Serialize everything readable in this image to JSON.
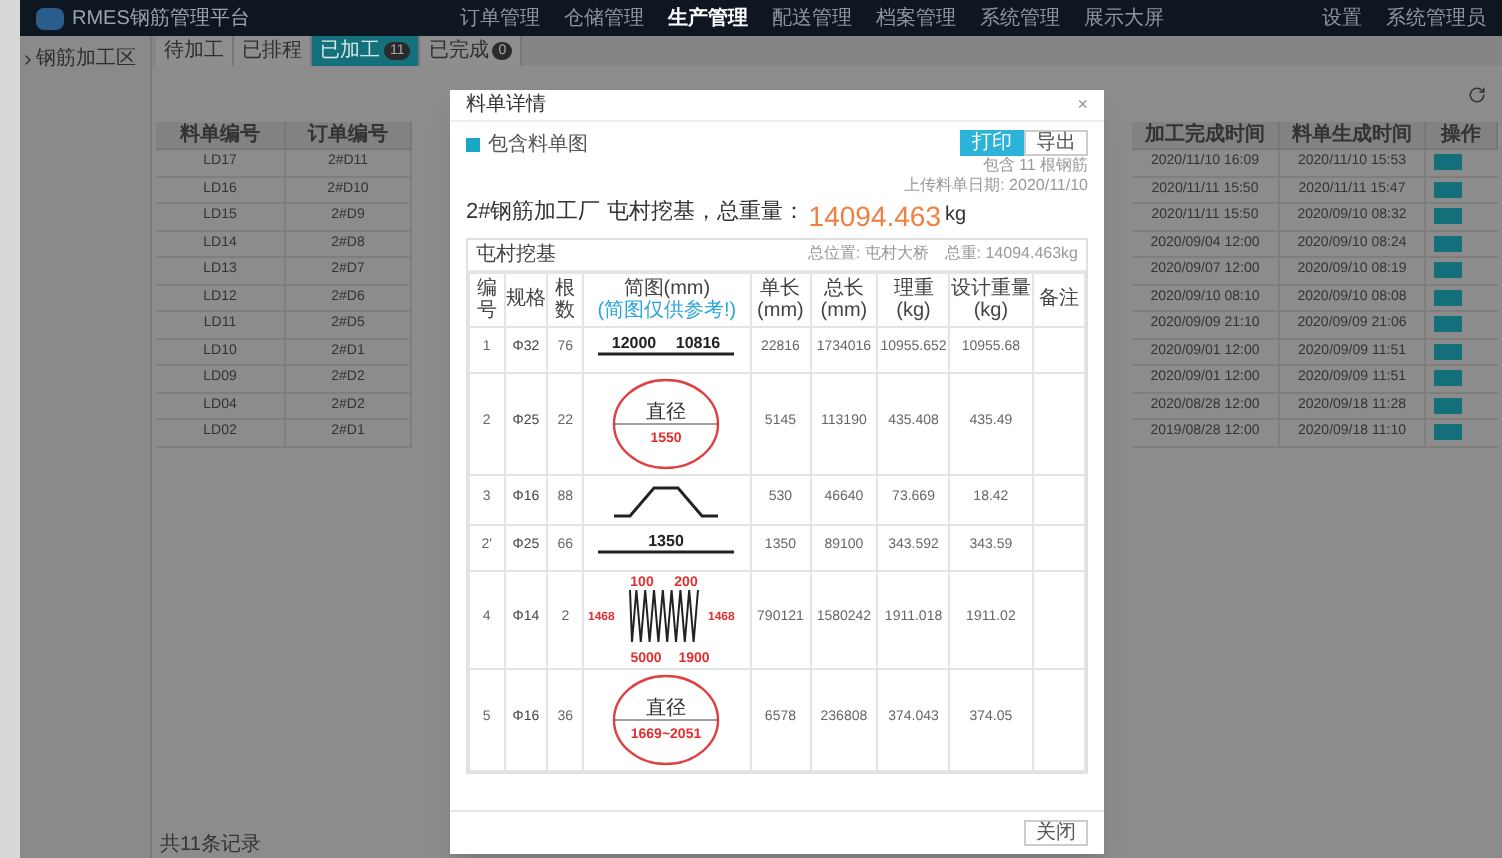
{
  "app": {
    "title": "RMES钢筋管理平台"
  },
  "nav": [
    {
      "label": "订单管理",
      "selected": false
    },
    {
      "label": "仓储管理",
      "selected": false
    },
    {
      "label": "生产管理",
      "selected": true
    },
    {
      "label": "配送管理",
      "selected": false
    },
    {
      "label": "档案管理",
      "selected": false
    },
    {
      "label": "系统管理",
      "selected": false
    },
    {
      "label": "展示大屏",
      "selected": false
    }
  ],
  "user_menu": [
    "设置",
    "系统管理员"
  ],
  "sidebar": {
    "items": [
      {
        "label": "钢筋加工区",
        "expanded": false
      }
    ]
  },
  "tabs": [
    {
      "label": "待加工",
      "selected": false
    },
    {
      "label": "已排程",
      "selected": false
    },
    {
      "label": "已加工",
      "count": "11",
      "selected": true
    },
    {
      "label": "已完成",
      "count": "0",
      "selected": false
    }
  ],
  "table": {
    "columns": [
      "料单编号",
      "订单编号",
      "加工完成时间",
      "料单生成时间",
      "操作"
    ],
    "rows": [
      [
        "LD17",
        "2#D11",
        "2020/11/10 16:09",
        "2020/11/10 15:53"
      ],
      [
        "LD16",
        "2#D10",
        "2020/11/11 15:50",
        "2020/11/11 15:47"
      ],
      [
        "LD15",
        "2#D9",
        "2020/11/11 15:50",
        "2020/09/10 08:32"
      ],
      [
        "LD14",
        "2#D8",
        "2020/09/04 12:00",
        "2020/09/10 08:24"
      ],
      [
        "LD13",
        "2#D7",
        "2020/09/07 12:00",
        "2020/09/10 08:19"
      ],
      [
        "LD12",
        "2#D6",
        "2020/09/10 08:10",
        "2020/09/10 08:08"
      ],
      [
        "LD11",
        "2#D5",
        "2020/09/09 21:10",
        "2020/09/09 21:06"
      ],
      [
        "LD10",
        "2#D1",
        "2020/09/01 12:00",
        "2020/09/09 11:51"
      ],
      [
        "LD09",
        "2#D2",
        "2020/09/01 12:00",
        "2020/09/09 11:51"
      ],
      [
        "LD04",
        "2#D2",
        "2020/08/28 12:00",
        "2020/09/18 11:28"
      ],
      [
        "LD02",
        "2#D1",
        "2019/08/28 12:00",
        "2020/09/18 11:10"
      ]
    ]
  },
  "status_bar": "共11条记录",
  "modal": {
    "title": "料单详情",
    "close": "×",
    "include_sketch": {
      "label": "包含料单图",
      "checked": true
    },
    "buttons": [
      {
        "label": "打印",
        "primary": true
      },
      {
        "label": "导出",
        "primary": false
      }
    ],
    "heading": "2#钢筋加工厂 屯村挖基，总重量：",
    "total": "14094.463",
    "unit": "kg",
    "info": [
      "包含 11 根钢筋",
      "上传料单日期: 2020/11/10"
    ],
    "panel": {
      "title": "屯村挖基",
      "location": "总位置: 屯村大桥",
      "weight": "总重: 14094.463kg"
    },
    "columns": [
      "编号",
      "规格",
      "根数",
      "简图(mm)",
      "单长(mm)",
      "总长(mm)",
      "理重(kg)",
      "设计重量(kg)",
      "备注"
    ],
    "sketch_note": "(简图仅供参考!)",
    "rows": [
      {
        "no": "1",
        "spec": "Φ32",
        "count": "76",
        "sketch": {
          "kind": "line",
          "labels": [
            "12000",
            "10816"
          ]
        },
        "values": [
          "22816",
          "1734016",
          "10955.652",
          "10955.68"
        ]
      },
      {
        "no": "2",
        "spec": "Φ25",
        "count": "22",
        "sketch": {
          "kind": "circle",
          "labels": [
            "直径",
            "1550"
          ]
        },
        "values": [
          "5145",
          "113190",
          "435.408",
          "435.49"
        ]
      },
      {
        "no": "3",
        "spec": "Φ16",
        "count": "88",
        "sketch": {
          "kind": "trapezoid"
        },
        "values": [
          "530",
          "46640",
          "73.669",
          "18.42"
        ]
      },
      {
        "no": "2'",
        "spec": "Φ25",
        "count": "66",
        "sketch": {
          "kind": "line",
          "labels": [
            "1350"
          ]
        },
        "values": [
          "1350",
          "89100",
          "343.592",
          "343.59"
        ]
      },
      {
        "no": "4",
        "spec": "Φ14",
        "count": "2",
        "sketch": {
          "kind": "spring",
          "labels": [
            "100",
            "200",
            "1468",
            "1468",
            "5000",
            "1900"
          ]
        },
        "values": [
          "790121",
          "1580242",
          "1911.018",
          "1911.02"
        ]
      },
      {
        "no": "5",
        "spec": "Φ16",
        "count": "36",
        "sketch": {
          "kind": "circle",
          "labels": [
            "直径",
            "1669~2051"
          ]
        },
        "values": [
          "6578",
          "236808",
          "374.043",
          "374.05"
        ]
      }
    ],
    "footer_button": "关闭"
  }
}
